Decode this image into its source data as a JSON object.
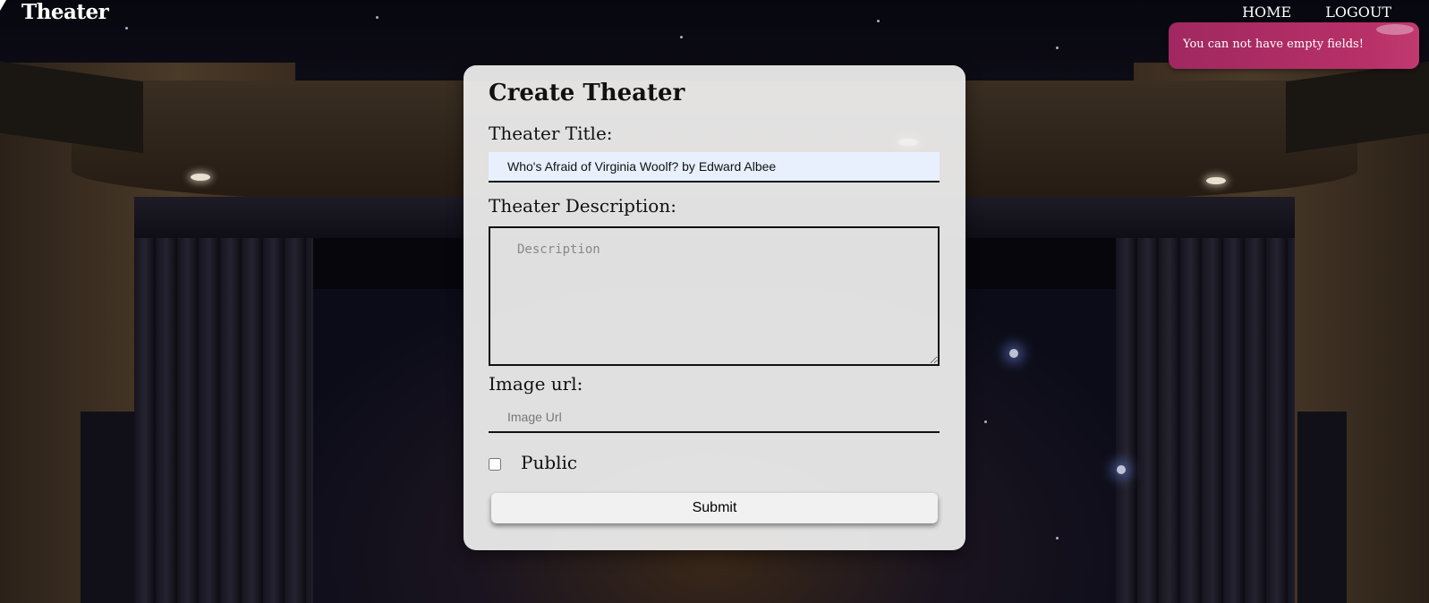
{
  "nav": {
    "brand": "Theater",
    "links": [
      "HOME",
      "LOGOUT"
    ]
  },
  "toast": {
    "message": "You can not have empty fields!",
    "color": "#b02a64"
  },
  "form": {
    "title": "Create Theater",
    "title_label": "Theater Title:",
    "title_value": "Who's Afraid of Virginia Woolf? by Edward Albee",
    "description_label": "Theater Description:",
    "description_placeholder": "Description",
    "image_label": "Image url:",
    "image_placeholder": "Image Url",
    "public_label": "Public",
    "public_checked": false,
    "submit_label": "Submit"
  }
}
